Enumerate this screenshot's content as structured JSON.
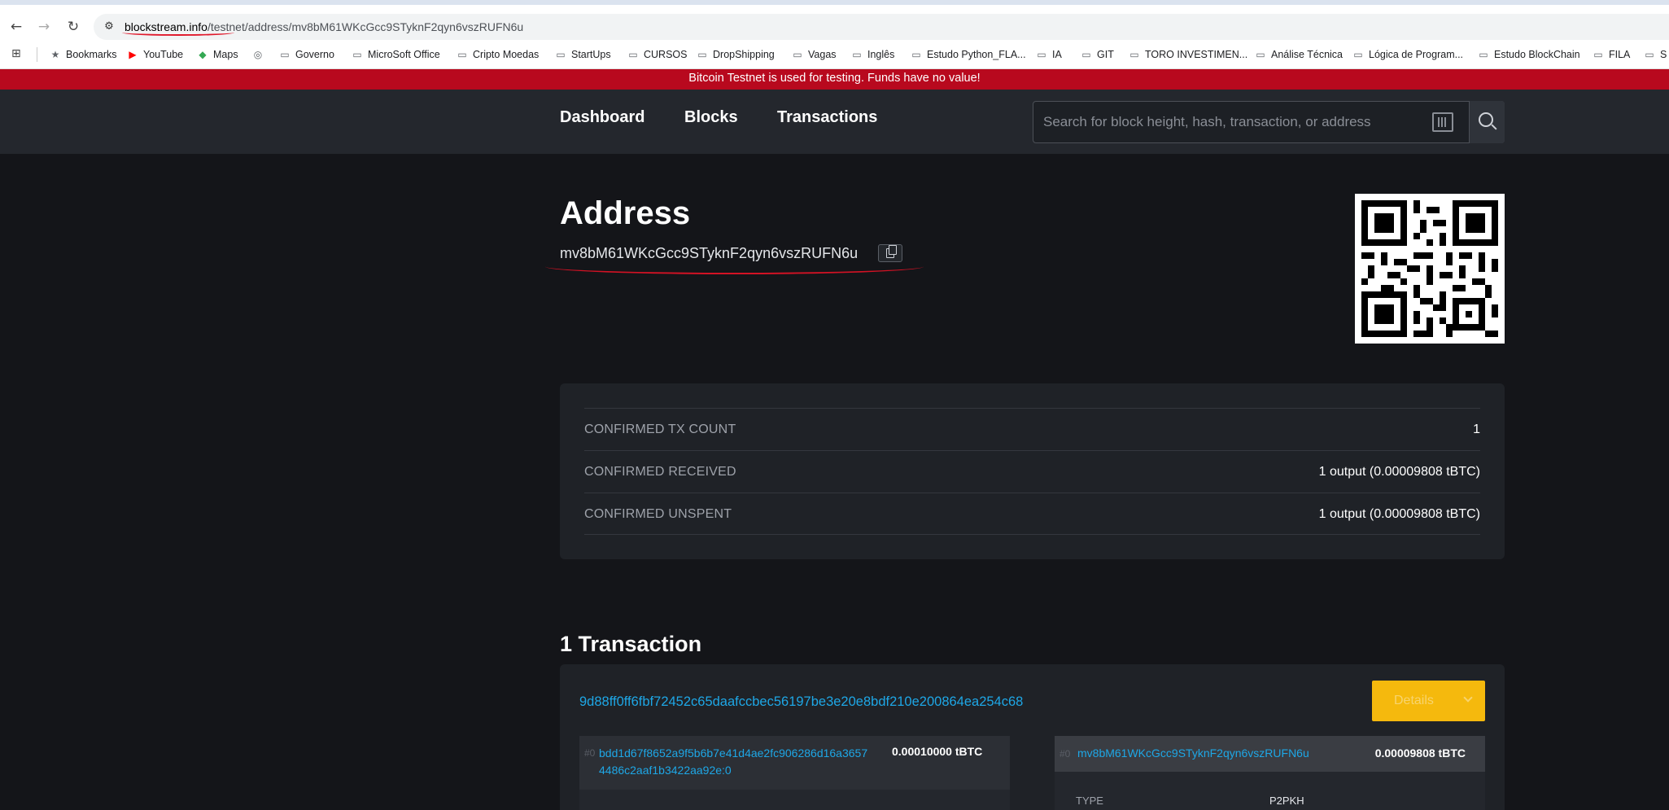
{
  "browser": {
    "url_host": "blockstream.info",
    "url_path": "/testnet/address/mv8bM61WKcGcc9STyknF2qyn6vszRUFN6u",
    "bookmarks": [
      {
        "icon": "star-icon",
        "label": "Bookmarks"
      },
      {
        "icon": "youtube-icon",
        "label": "YouTube"
      },
      {
        "icon": "maps-icon",
        "label": "Maps"
      },
      {
        "icon": "globe-icon",
        "label": ""
      },
      {
        "icon": "folder-icon",
        "label": "Governo"
      },
      {
        "icon": "folder-icon",
        "label": "MicroSoft Office"
      },
      {
        "icon": "folder-icon",
        "label": "Cripto Moedas"
      },
      {
        "icon": "folder-icon",
        "label": "StartUps"
      },
      {
        "icon": "folder-icon",
        "label": "CURSOS"
      },
      {
        "icon": "folder-icon",
        "label": "DropShipping"
      },
      {
        "icon": "folder-icon",
        "label": "Vagas"
      },
      {
        "icon": "folder-icon",
        "label": "Inglês"
      },
      {
        "icon": "folder-icon",
        "label": "Estudo Python_FLA..."
      },
      {
        "icon": "folder-icon",
        "label": "IA"
      },
      {
        "icon": "folder-icon",
        "label": "GIT"
      },
      {
        "icon": "folder-icon",
        "label": "TORO INVESTIMEN..."
      },
      {
        "icon": "folder-icon",
        "label": "Análise Técnica"
      },
      {
        "icon": "folder-icon",
        "label": "Lógica de Program..."
      },
      {
        "icon": "folder-icon",
        "label": "Estudo BlockChain"
      },
      {
        "icon": "folder-icon",
        "label": "FILA"
      },
      {
        "icon": "folder-icon",
        "label": "S"
      }
    ]
  },
  "banner": {
    "text": "Bitcoin Testnet is used for testing. Funds have no value!"
  },
  "nav": {
    "dashboard": "Dashboard",
    "blocks": "Blocks",
    "transactions": "Transactions",
    "search_placeholder": "Search for block height, hash, transaction, or address"
  },
  "address": {
    "heading": "Address",
    "value": "mv8bM61WKcGcc9STyknF2qyn6vszRUFN6u"
  },
  "stats": [
    {
      "label": "CONFIRMED TX COUNT",
      "value": "1"
    },
    {
      "label": "CONFIRMED RECEIVED",
      "value": "1 output (0.00009808 tBTC)"
    },
    {
      "label": "CONFIRMED UNSPENT",
      "value": "1 output (0.00009808 tBTC)"
    }
  ],
  "transactions": {
    "heading": "1 Transaction",
    "items": [
      {
        "txid": "9d88ff0ff6fbf72452c65daafccbec56197be3e20e8bdf210e200864ea254c68",
        "details_label": "Details",
        "vin": {
          "index": "#0",
          "prevout": "bdd1d67f8652a9f5b6b7e41d4ae2fc906286d16a3657 4486c2aaf1b3422aa92e:0",
          "amount": "0.00010000 tBTC"
        },
        "vout": {
          "index": "#0",
          "address": "mv8bM61WKcGcc9STyknF2qyn6vszRUFN6u",
          "amount": "0.00009808 tBTC",
          "type_label": "TYPE",
          "type_value": "P2PKH"
        }
      }
    ]
  },
  "colors": {
    "banner": "#b8091e",
    "nav_bg": "#24272d",
    "page_bg": "#141519",
    "link": "#1ea7e6",
    "accent": "#f5b90d"
  }
}
